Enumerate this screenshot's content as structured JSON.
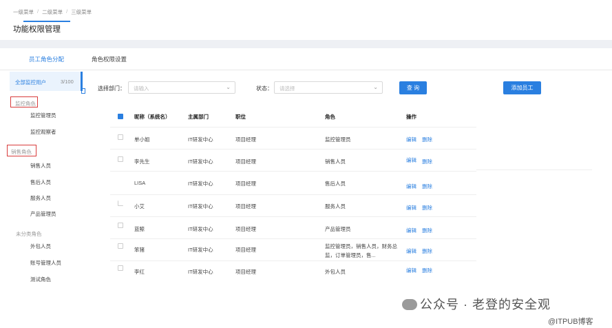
{
  "breadcrumb": [
    "一级菜单",
    "二级菜单",
    "三级菜单"
  ],
  "page_title": "功能权限管理",
  "tabs": [
    {
      "label": "员工角色分配",
      "active": true
    },
    {
      "label": "角色权限设置",
      "active": false
    }
  ],
  "sidebar": {
    "all_users": {
      "label": "全部监控用户",
      "count": "3/100"
    },
    "groups": [
      {
        "title": "监控角色",
        "items": [
          "监控管理员",
          "监控观察者"
        ]
      },
      {
        "title": "销售角色",
        "items": [
          "销售人员",
          "售后人员",
          "服务人员",
          "产品管理员"
        ]
      },
      {
        "title": "未分类角色",
        "items": [
          "外包人员",
          "账号管理人员",
          "测试角色"
        ]
      }
    ]
  },
  "filters": {
    "dept_label": "选择部门：",
    "dept_placeholder": "请输入",
    "status_label": "状态：",
    "status_placeholder": "请选择",
    "query_button": "查 询",
    "add_button": "添加员工"
  },
  "table": {
    "headers": [
      "昵称（系统名）",
      "主属部门",
      "职位",
      "角色",
      "操作"
    ],
    "rows": [
      {
        "name": "单小姐",
        "dept": "IT研发中心",
        "position": "项目经理",
        "role": "监控管理员"
      },
      {
        "name": "李先生",
        "dept": "IT研发中心",
        "position": "项目经理",
        "role": "销售人员"
      },
      {
        "name": "LISA",
        "dept": "IT研发中心",
        "position": "项目经理",
        "role": "售后人员"
      },
      {
        "name": "小艾",
        "dept": "IT研发中心",
        "position": "项目经理",
        "role": "服务人员"
      },
      {
        "name": "蓝鲸",
        "dept": "IT研发中心",
        "position": "项目经理",
        "role": "产品管理员"
      },
      {
        "name": "笨猪",
        "dept": "IT研发中心",
        "position": "项目经理",
        "role": "监控管理员，销售人员，财务总监，订单管理员，售..."
      },
      {
        "name": "李红",
        "dept": "IT研发中心",
        "position": "项目经理",
        "role": "外包人员"
      }
    ],
    "edit_label": "编辑",
    "delete_label": "删除"
  },
  "watermark": {
    "main": "公众号 · 老登的安全观",
    "sub": "@ITPUB博客"
  },
  "colors": {
    "accent": "#2a7fe0",
    "highlight_box": "#d83a3a"
  }
}
